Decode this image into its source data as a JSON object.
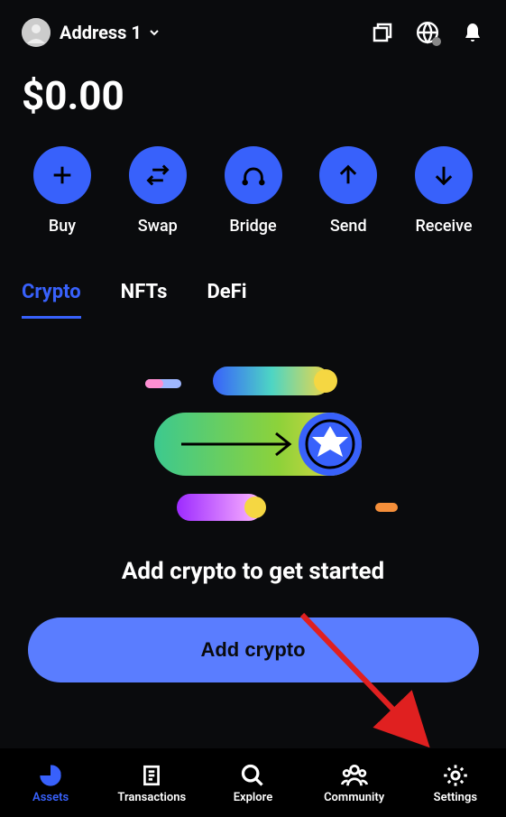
{
  "header": {
    "account_name": "Address 1"
  },
  "balance": "$0.00",
  "actions": {
    "buy": "Buy",
    "swap": "Swap",
    "bridge": "Bridge",
    "send": "Send",
    "receive": "Receive"
  },
  "tabs": {
    "crypto": "Crypto",
    "nfts": "NFTs",
    "defi": "DeFi"
  },
  "empty_state": {
    "title": "Add crypto to get started",
    "cta_label": "Add crypto"
  },
  "nav": {
    "assets": "Assets",
    "transactions": "Transactions",
    "explore": "Explore",
    "community": "Community",
    "settings": "Settings"
  },
  "colors": {
    "accent": "#3861fb",
    "cta": "#5a7dff"
  }
}
